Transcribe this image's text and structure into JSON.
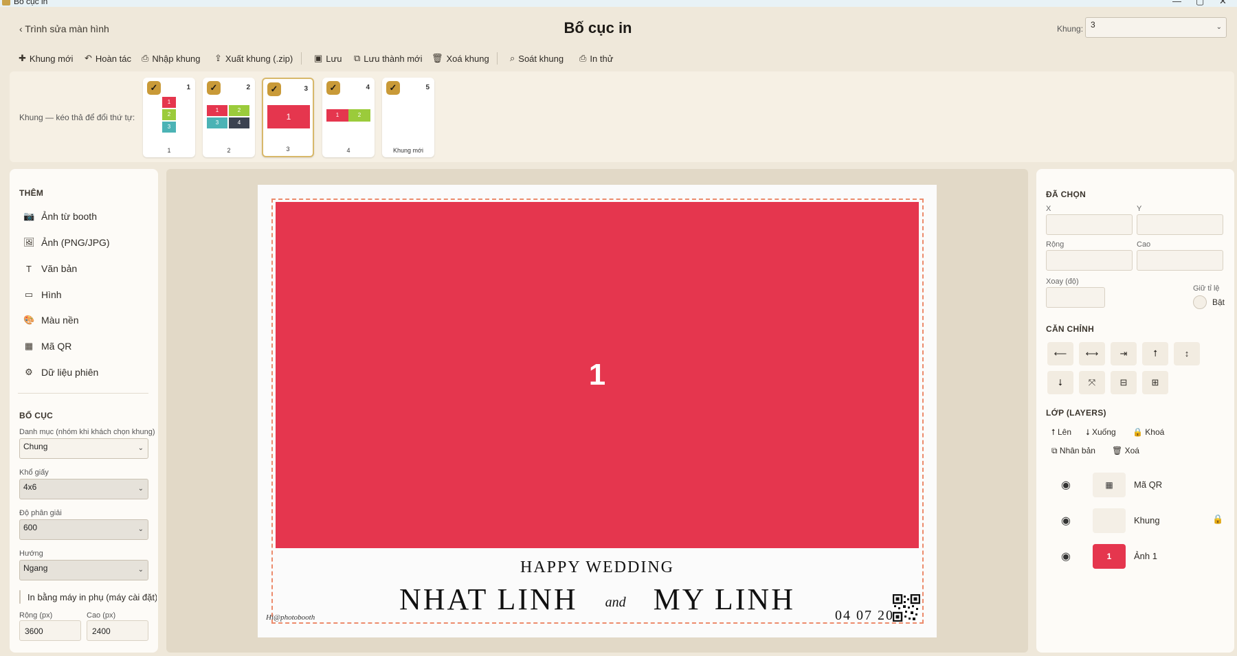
{
  "window": {
    "title": "Bố cục in",
    "minimize": "—",
    "maximize": "▢",
    "close": "✕"
  },
  "header": {
    "back_label": "‹ Trình sửa màn hình",
    "title": "Bố cục in",
    "frame_label": "Khung:",
    "frame_value": "3"
  },
  "toolbar": {
    "new_frame": "Khung mới",
    "undo": "Hoàn tác",
    "import": "Nhập khung",
    "export": "Xuất khung (.zip)",
    "save": "Lưu",
    "save_as": "Lưu thành mới",
    "delete": "Xoá khung",
    "review": "Soát khung",
    "print_test": "In thử"
  },
  "strip": {
    "label": "Khung — kéo thả để đổi thứ tự:",
    "frames": [
      {
        "num": "1",
        "caption": "1",
        "checked": true
      },
      {
        "num": "2",
        "caption": "2",
        "checked": true
      },
      {
        "num": "3",
        "caption": "3",
        "checked": true,
        "selected": true
      },
      {
        "num": "4",
        "caption": "4",
        "checked": true
      },
      {
        "num": "5",
        "caption": "Khung mới",
        "checked": true
      }
    ],
    "mini_labels": {
      "a": "1",
      "b": "2",
      "c": "3",
      "d": "4"
    }
  },
  "left": {
    "add_title": "THÊM",
    "add_items": [
      "Ảnh từ booth",
      "Ảnh (PNG/JPG)",
      "Văn bản",
      "Hình",
      "Màu nền",
      "Mã QR",
      "Dữ liệu phiên"
    ],
    "layout_title": "BỐ CỤC",
    "category_label": "Danh mục (nhóm khi khách chọn khung)",
    "category_value": "Chung",
    "paper_label": "Khổ giấy",
    "paper_value": "4x6",
    "dpi_label": "Độ phân giải",
    "dpi_value": "600",
    "orient_label": "Hướng",
    "orient_value": "Ngang",
    "aux_print_label": "In bằng máy in phụ (máy cài đặt)",
    "width_label": "Rộng (px)",
    "width_value": "3600",
    "height_label": "Cao (px)",
    "height_value": "2400"
  },
  "canvas": {
    "photo_label": "1",
    "happy_wedding": "HAPPY WEDDING",
    "name1": "NHAT LINH",
    "and": "and",
    "name2": "MY LINH",
    "brand": "Hi@photobooth",
    "date": "04 07 2025"
  },
  "right": {
    "selected_title": "ĐÃ CHỌN",
    "x_label": "X",
    "y_label": "Y",
    "w_label": "Rộng",
    "h_label": "Cao",
    "rot_label": "Xoay (độ)",
    "keep_ratio_label": "Giữ tỉ lệ",
    "keep_ratio_on": "Bật",
    "align_title": "CĂN CHỈNH",
    "align_buttons": [
      "⟵",
      "⟷",
      "⇥",
      "⭡",
      "↕",
      "⭣",
      "⤧",
      "⊟",
      "⊞"
    ],
    "layers_title": "LỚP (LAYERS)",
    "layer_up": "⭡ Lên",
    "layer_down": "⭣ Xuống",
    "layer_lock": "🔒 Khoá",
    "layer_dup": "⧉ Nhân bản",
    "layer_del": "🗑 Xoá",
    "layers": [
      {
        "name": "Mã QR",
        "thumb": "▦"
      },
      {
        "name": "Khung",
        "thumb": "",
        "locked": true
      },
      {
        "name": "Ảnh 1",
        "thumb": "1"
      }
    ]
  },
  "colors": {
    "accent": "#e5364e",
    "check": "#c99a38",
    "guide": "#ec8a6b",
    "bg": "#efe8da"
  }
}
